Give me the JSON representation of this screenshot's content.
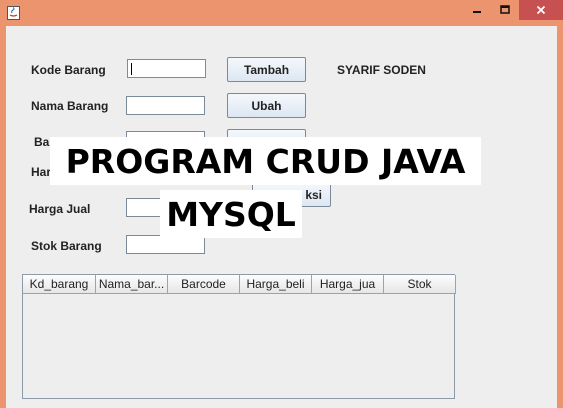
{
  "window": {
    "title": ""
  },
  "form": {
    "labels": {
      "kode": "Kode Barang",
      "nama": "Nama Barang",
      "barcode": "Ba",
      "harga_beli": "Har",
      "harga_jual": "Harga Jual",
      "stok": "Stok Barang"
    },
    "buttons": {
      "tambah": "Tambah",
      "ubah": "Ubah",
      "transaksi": "ksi"
    },
    "author": "SYARIF SODEN"
  },
  "table": {
    "columns": [
      "Kd_barang",
      "Nama_bar...",
      "Barcode",
      "Harga_beli",
      "Harga_jua",
      "Stok"
    ],
    "rows": []
  },
  "overlay": {
    "line1": "PROGRAM CRUD JAVA",
    "line2": "MYSQL"
  },
  "colors": {
    "titlebar": "#ec946d",
    "close_button": "#c75050",
    "window_bg": "#eeeeee"
  }
}
